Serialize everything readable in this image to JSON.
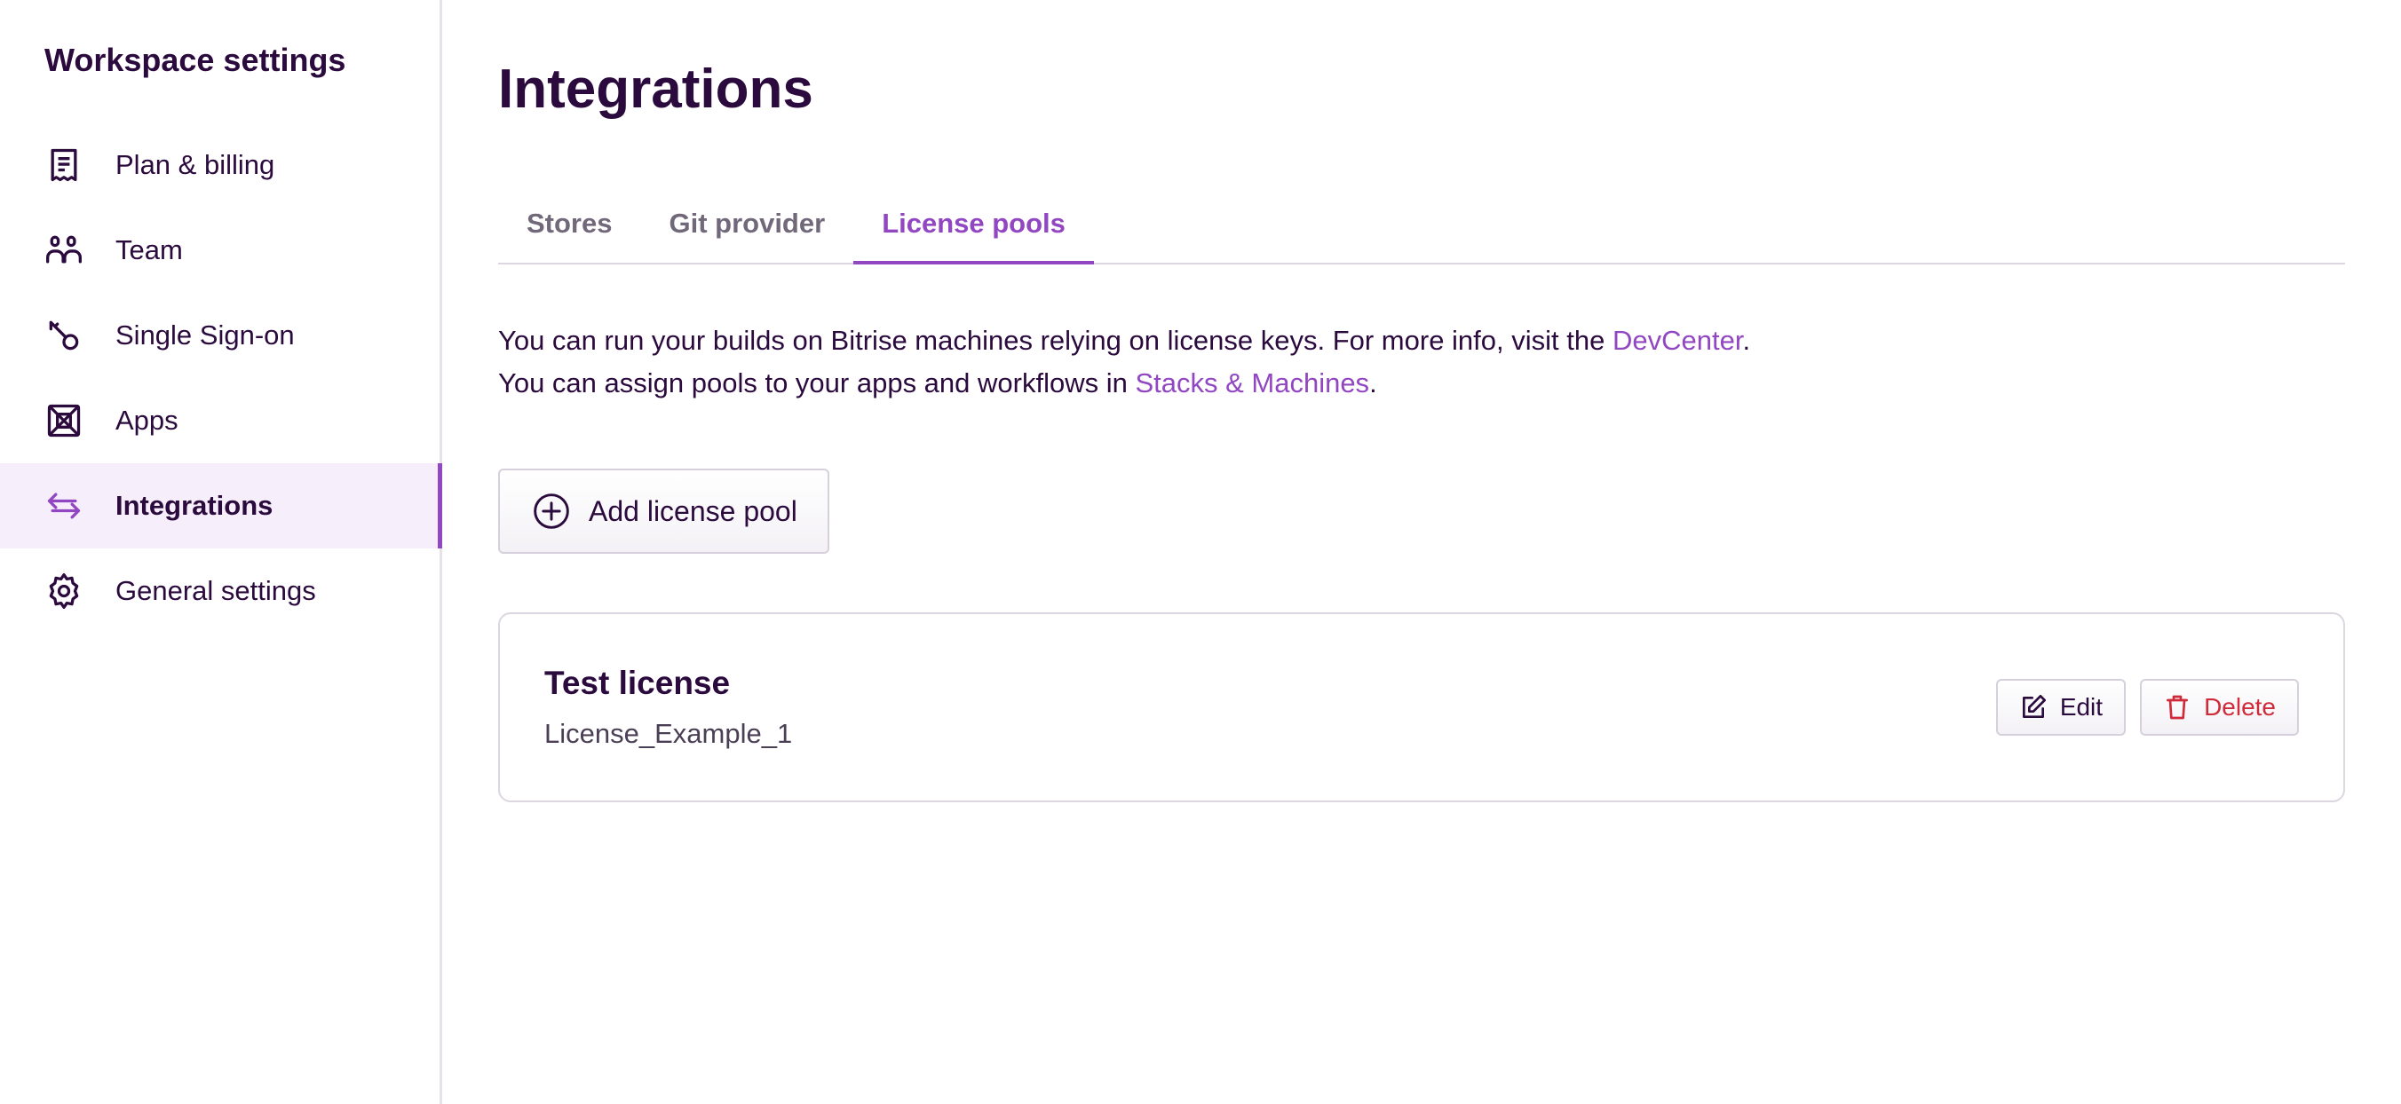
{
  "sidebar": {
    "title": "Workspace settings",
    "items": [
      {
        "label": "Plan & billing",
        "icon": "receipt-icon"
      },
      {
        "label": "Team",
        "icon": "team-icon"
      },
      {
        "label": "Single Sign-on",
        "icon": "key-icon"
      },
      {
        "label": "Apps",
        "icon": "apps-icon"
      },
      {
        "label": "Integrations",
        "icon": "arrows-icon",
        "active": true
      },
      {
        "label": "General settings",
        "icon": "gear-icon"
      }
    ]
  },
  "main": {
    "title": "Integrations",
    "tabs": [
      {
        "label": "Stores"
      },
      {
        "label": "Git provider"
      },
      {
        "label": "License pools",
        "active": true
      }
    ],
    "description": {
      "line1_prefix": "You can run your builds on Bitrise machines relying on license keys. For more info, visit the ",
      "line1_link": "DevCenter",
      "line1_suffix": ".",
      "line2_prefix": "You can assign pools to your apps and workflows in ",
      "line2_link": "Stacks & Machines",
      "line2_suffix": "."
    },
    "add_button": "Add license pool",
    "license": {
      "title": "Test license",
      "subtitle": "License_Example_1",
      "edit_label": "Edit",
      "delete_label": "Delete"
    }
  },
  "colors": {
    "accent": "#9247c2",
    "text": "#2b0a3d",
    "danger": "#cf2b3a",
    "active_bg": "#f6eefb"
  }
}
